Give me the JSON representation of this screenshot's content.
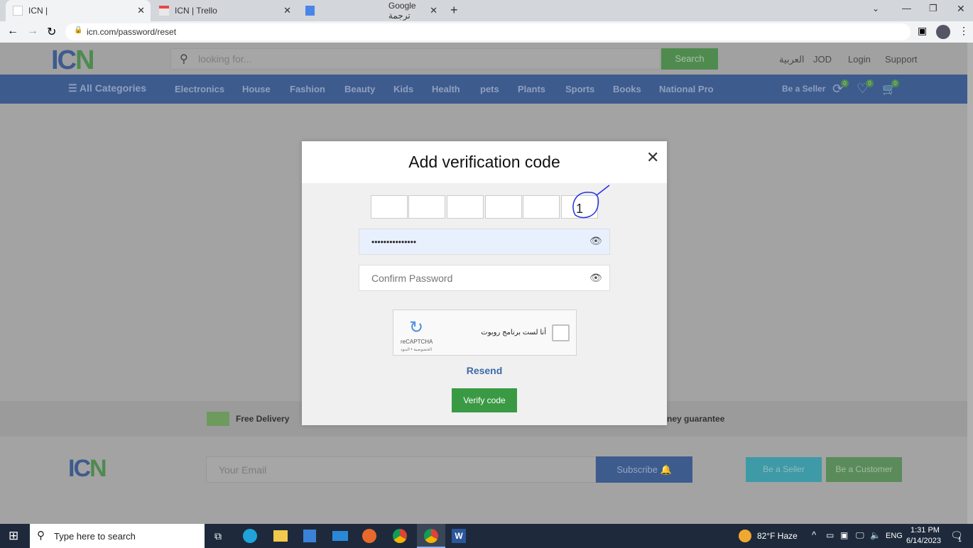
{
  "browser": {
    "tabs": [
      {
        "title": "ICN |"
      },
      {
        "title": "ICN | Trello"
      },
      {
        "title": "Google ترجمة"
      }
    ],
    "url": "icn.com/password/reset"
  },
  "header": {
    "search_placeholder": "looking for...",
    "search_button": "Search",
    "links": [
      "العربية",
      "JOD",
      "Login",
      "Support"
    ]
  },
  "nav": {
    "all_categories": "All Categories",
    "items": [
      "Electronics",
      "House",
      "Fashion",
      "Beauty",
      "Kids",
      "Health",
      "pets",
      "Plants",
      "Sports",
      "Books",
      "National Pro"
    ],
    "be_seller": "Be a Seller",
    "compare_count": "0",
    "wishlist_count": "0",
    "cart_count": "0"
  },
  "features": {
    "delivery": "Free Delivery",
    "money": "ney guarantee"
  },
  "footer": {
    "email_placeholder": "Your Email",
    "subscribe": "Subscribe",
    "be_seller": "Be a Seller",
    "be_customer": "Be a Customer"
  },
  "modal": {
    "title": "Add verification code",
    "codes": [
      "",
      "",
      "",
      "",
      "",
      "1"
    ],
    "password_value": "•••••••••••••••",
    "confirm_placeholder": "Confirm Password",
    "captcha_label": "أنا لست برنامج روبوت",
    "captcha_brand": "reCAPTCHA",
    "captcha_sub": "الخصوصية • البنود",
    "resend": "Resend",
    "verify": "Verify code"
  },
  "taskbar": {
    "search_placeholder": "Type here to search",
    "weather": "82°F  Haze",
    "lang": "ENG",
    "time": "1:31 PM",
    "date": "6/14/2023",
    "notifications": "1"
  },
  "colors": {
    "nav": "#3e5b8e",
    "green": "#3a9a44",
    "resend": "#3d6aa8"
  }
}
